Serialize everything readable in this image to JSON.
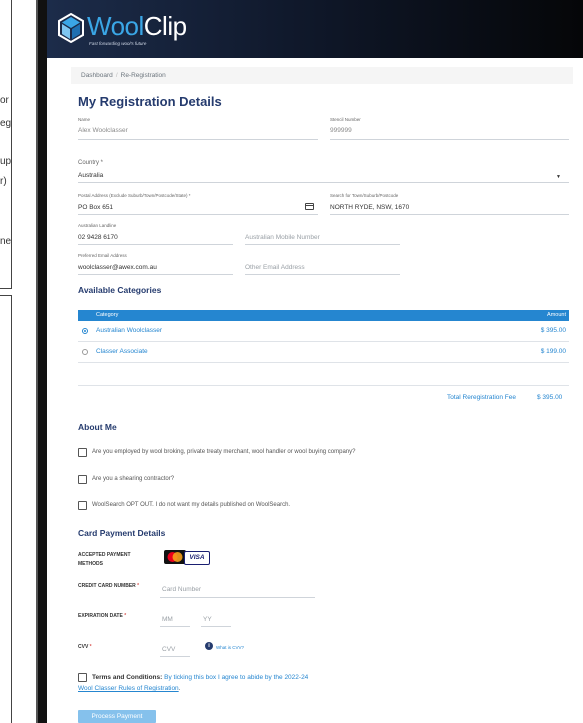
{
  "background_fragments": [
    "or",
    "eg",
    "up",
    "r)",
    "ne"
  ],
  "header": {
    "logo_word_1": "Wool",
    "logo_word_2": "Clip",
    "tagline": "Fast forwarding wool's future"
  },
  "breadcrumb": {
    "home": "Dashboard",
    "separator": "/",
    "current": "Re-Registration"
  },
  "page_title": "My Registration Details",
  "fields": {
    "name": {
      "label": "Name",
      "value": "Alex Woolclasser"
    },
    "stencil": {
      "label": "Stencil Number",
      "value": "999999"
    },
    "country": {
      "label": "Country *",
      "value": "Australia"
    },
    "postal_address": {
      "label": "Postal Address (Exclude Suburb/Town/Postcode/State) *",
      "value": "PO Box 651"
    },
    "suburb_search": {
      "label": "Search for Town/Suburb/Postcode",
      "value": "NORTH RYDE, NSW, 1670"
    },
    "landline": {
      "label": "Australian Landline",
      "value": "02 9428 6170"
    },
    "mobile": {
      "placeholder": "Australian Mobile Number"
    },
    "email": {
      "label": "Preferred Email Address",
      "value": "woolclasser@awex.com.au"
    },
    "other_email": {
      "placeholder": "Other Email Address"
    }
  },
  "categories": {
    "title": "Available Categories",
    "header_category": "Category",
    "header_amount": "Amount",
    "rows": [
      {
        "name": "Australian Woolclasser",
        "amount": "$ 395.00",
        "selected": true
      },
      {
        "name": "Classer Associate",
        "amount": "$ 199.00",
        "selected": false
      }
    ],
    "total_label": "Total Reregistration Fee",
    "total_value": "$ 395.00"
  },
  "about": {
    "title": "About Me",
    "questions": [
      "Are you employed by wool broking, private treaty merchant, wool handler or wool buying company?",
      "Are you a shearing contractor?",
      "WoolSearch OPT OUT. I do not want my details published on WoolSearch."
    ]
  },
  "payment": {
    "title": "Card Payment Details",
    "accepted_label_1": "ACCEPTED PAYMENT",
    "accepted_label_2": "METHODS",
    "visa_text": "VISA",
    "card_number_label": "CREDIT CARD NUMBER",
    "card_number_placeholder": "Card Number",
    "expiry_label": "EXPIRATION DATE",
    "mm_placeholder": "MM",
    "yy_placeholder": "YY",
    "cvv_label": "CVV",
    "cvv_placeholder": "CVV",
    "cvv_link": "What is CVV?",
    "required_mark": "*"
  },
  "terms": {
    "bold": "Terms and Conditions:",
    "text": "By ticking this box I agree to abide by the 2022-24",
    "link": "Wool Classer Rules of Registration",
    "end": "."
  },
  "submit_label": "Process Payment",
  "colors": {
    "brand_blue": "#2586d0",
    "title_navy": "#253b6e",
    "button_light_blue": "#85c1ec"
  }
}
